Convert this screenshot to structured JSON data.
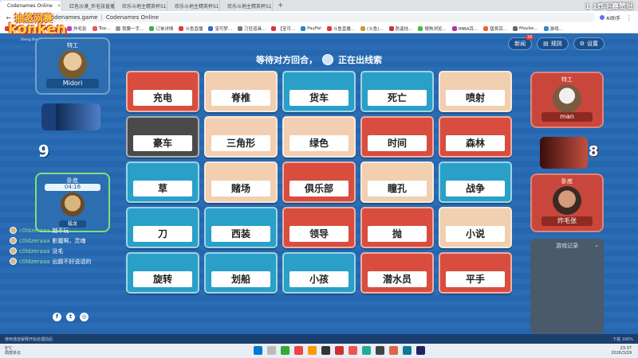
{
  "browser": {
    "tabs": [
      {
        "label": "Codenames Online",
        "active": true
      },
      {
        "label": "红色沙漠_炸毛张直播_炸毛...",
        "active": false
      },
      {
        "label": "欢乐斗地主精英杯S1_黄...",
        "active": false
      },
      {
        "label": "欢乐斗地主精英杯S1_问鼎...",
        "active": false
      },
      {
        "label": "欢乐斗地主精英杯S1_一层...",
        "active": false
      }
    ],
    "url": "codenames.game",
    "page_title": "Codenames Online",
    "ai_helper": "AI助手",
    "bookmarks": [
      "推荐",
      "我知",
      "办公",
      "炸毛张",
      "Top...",
      "我要一手...",
      "订单详情",
      "斗鱼直播",
      "宝可梦...",
      "刀狂道具...",
      "【宝可...",
      "PayPal",
      "斗鱼直播...",
      "(斗鱼)...",
      "防盗挂...",
      "搜狗浏览...",
      "IMBA百...",
      "猛将百...",
      "Maybe...",
      "游戏..."
    ]
  },
  "watermark": "1 1炸毛赛赞批",
  "logo": {
    "top": "抽签网赛",
    "big": "konken",
    "small": "Sheng Sheng Pan Jing"
  },
  "game": {
    "status_text_left": "等待对方回合，",
    "status_text_right": "正在出线索",
    "buttons": {
      "news": "新闻",
      "news_badge": "18",
      "rules": "规则",
      "settings": "设置"
    },
    "blue_team": {
      "spymaster_title": "特工",
      "spymaster_name": "Midori",
      "remaining": "9",
      "operative_title": "卧底",
      "timer": "04:16",
      "operative_name": "猛龙"
    },
    "red_team": {
      "spymaster_title": "特工",
      "spymaster_name": "man",
      "remaining": "8",
      "operative_title": "卧底",
      "operative_name": "炸毛张"
    },
    "log_title": "游戏记录",
    "cards": [
      {
        "word": "充电",
        "color": "red"
      },
      {
        "word": "脊椎",
        "color": "neutral"
      },
      {
        "word": "货车",
        "color": "blue"
      },
      {
        "word": "死亡",
        "color": "blue"
      },
      {
        "word": "喷射",
        "color": "neutral"
      },
      {
        "word": "豪车",
        "color": "assassin"
      },
      {
        "word": "三角形",
        "color": "neutral"
      },
      {
        "word": "绿色",
        "color": "neutral"
      },
      {
        "word": "时间",
        "color": "red"
      },
      {
        "word": "森林",
        "color": "red"
      },
      {
        "word": "草",
        "color": "blue"
      },
      {
        "word": "赌场",
        "color": "neutral"
      },
      {
        "word": "俱乐部",
        "color": "red"
      },
      {
        "word": "瞳孔",
        "color": "neutral"
      },
      {
        "word": "战争",
        "color": "blue"
      },
      {
        "word": "刀",
        "color": "blue"
      },
      {
        "word": "西装",
        "color": "blue"
      },
      {
        "word": "领导",
        "color": "red"
      },
      {
        "word": "抛",
        "color": "red"
      },
      {
        "word": "小说",
        "color": "neutral"
      },
      {
        "word": "旋转",
        "color": "blue"
      },
      {
        "word": "划船",
        "color": "blue"
      },
      {
        "word": "小孩",
        "color": "blue"
      },
      {
        "word": "潜水员",
        "color": "red"
      },
      {
        "word": "平手",
        "color": "red"
      }
    ],
    "chat": [
      {
        "user": "c0ldzeraaa",
        "msg": "她不玩"
      },
      {
        "user": "c0ldzeraaa",
        "msg": "影魔啊，灵魂"
      },
      {
        "user": "c0ldzeraaa",
        "msg": "没毛"
      },
      {
        "user": "c0ldzeraaa",
        "msg": "出题不好说话的"
      }
    ],
    "statusline_left": "使用谐音解释开始处理前后",
    "statusline_right": "下载    100%"
  },
  "taskbar": {
    "temp": "9°C",
    "weather": "局部多云",
    "time": "23:37",
    "date": "2026/3/29"
  },
  "colors": {
    "red": "#d94d3e",
    "blue": "#2aa0c8",
    "neutral": "#f1cfb0",
    "assassin": "#4a4a4a",
    "bg": "#1f5fa6"
  }
}
